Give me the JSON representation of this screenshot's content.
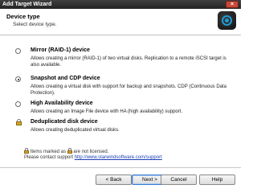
{
  "window": {
    "title": "Add Target Wizard",
    "close_label": "×"
  },
  "header": {
    "title": "Device type",
    "subtitle": "Select device type.",
    "logo_icon": "starwind-logo-icon"
  },
  "options": [
    {
      "name": "mirror",
      "title": "Mirror (RAID-1) device",
      "description": "Allows creating a mirror (RAID-1) of two virtual disks. Replication to a remote iSCSI target is also available.",
      "control": "radio",
      "selected": false
    },
    {
      "name": "snapshot-cdp",
      "title": "Snapshot and CDP device",
      "description": "Allows creating a virtual disk with support for backup and snapshots. CDP (Continuous Data Protection).",
      "control": "radio",
      "selected": true
    },
    {
      "name": "high-availability",
      "title": "High Availability device",
      "description": "Allows creating an Image File device with HA (high availability) support.",
      "control": "radio",
      "selected": false
    },
    {
      "name": "deduplicated",
      "title": "Deduplicated disk device",
      "description": "Allows creating deduplicated virtual disks.",
      "control": "lock",
      "selected": false
    }
  ],
  "license_note": {
    "prefix": "Items marked as",
    "suffix": "are not licensed.",
    "contact_prefix": "Please contact support",
    "link": "http://www.starwindsoftware.com/support"
  },
  "buttons": {
    "back": "< Back",
    "next": "Next >",
    "cancel": "Cancel",
    "help": "Help"
  },
  "colors": {
    "titlebar": "#2f2f2f",
    "link": "#1a3fb5",
    "logo_accent": "#1f9ad6"
  }
}
